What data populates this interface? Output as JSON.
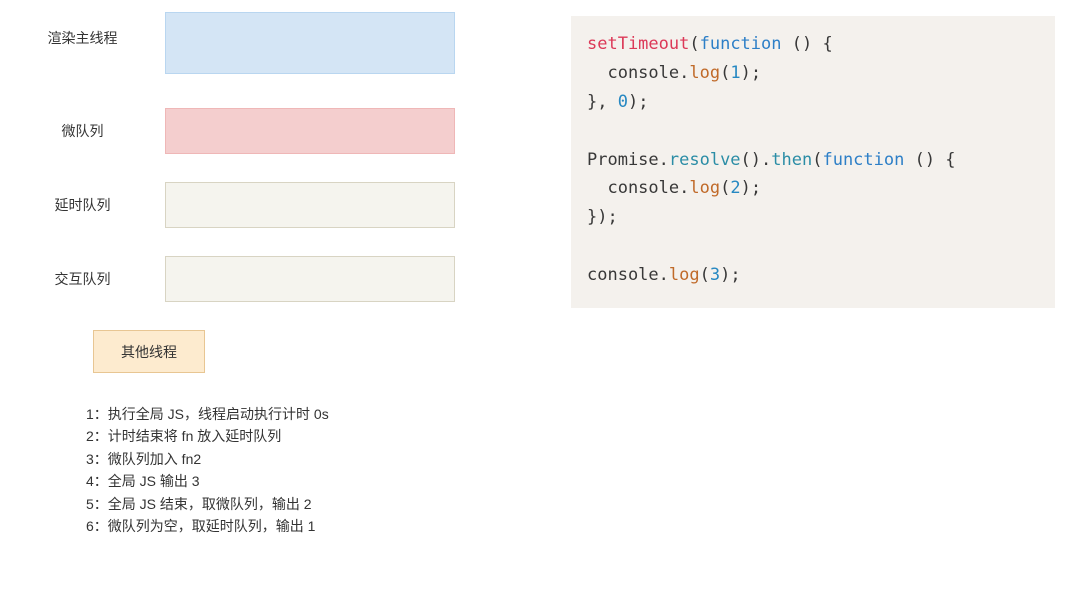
{
  "queues": {
    "main": {
      "label": "渲染主线程"
    },
    "micro": {
      "label": "微队列"
    },
    "delay": {
      "label": "延时队列"
    },
    "inter": {
      "label": "交互队列"
    }
  },
  "other_thread": {
    "label": "其他线程"
  },
  "steps": [
    "1：执行全局 JS，线程启动执行计时 0s",
    "2：计时结束将 fn 放入延时队列",
    "3：微队列加入 fn2",
    "4：全局 JS 输出 3",
    "5：全局 JS 结束，取微队列，输出 2",
    "6：微队列为空，取延时队列，输出 1"
  ],
  "code": [
    [
      {
        "t": "setTimeout",
        "c": "t-kw"
      },
      {
        "t": "(",
        "c": "t-plain"
      },
      {
        "t": "function ",
        "c": "t-kw2"
      },
      {
        "t": "() {",
        "c": "t-plain"
      }
    ],
    [
      {
        "t": "  console.",
        "c": "t-plain"
      },
      {
        "t": "log",
        "c": "t-log"
      },
      {
        "t": "(",
        "c": "t-plain"
      },
      {
        "t": "1",
        "c": "t-num"
      },
      {
        "t": ");",
        "c": "t-plain"
      }
    ],
    [
      {
        "t": "}, ",
        "c": "t-plain"
      },
      {
        "t": "0",
        "c": "t-num"
      },
      {
        "t": ");",
        "c": "t-plain"
      }
    ],
    [],
    [
      {
        "t": "Promise.",
        "c": "t-plain"
      },
      {
        "t": "resolve",
        "c": "t-prop"
      },
      {
        "t": "().",
        "c": "t-plain"
      },
      {
        "t": "then",
        "c": "t-prop"
      },
      {
        "t": "(",
        "c": "t-plain"
      },
      {
        "t": "function ",
        "c": "t-kw2"
      },
      {
        "t": "() {",
        "c": "t-plain"
      }
    ],
    [
      {
        "t": "  console.",
        "c": "t-plain"
      },
      {
        "t": "log",
        "c": "t-log"
      },
      {
        "t": "(",
        "c": "t-plain"
      },
      {
        "t": "2",
        "c": "t-num"
      },
      {
        "t": ");",
        "c": "t-plain"
      }
    ],
    [
      {
        "t": "});",
        "c": "t-plain"
      }
    ],
    [],
    [
      {
        "t": "console.",
        "c": "t-plain"
      },
      {
        "t": "log",
        "c": "t-log"
      },
      {
        "t": "(",
        "c": "t-plain"
      },
      {
        "t": "3",
        "c": "t-num"
      },
      {
        "t": ");",
        "c": "t-plain"
      }
    ]
  ]
}
